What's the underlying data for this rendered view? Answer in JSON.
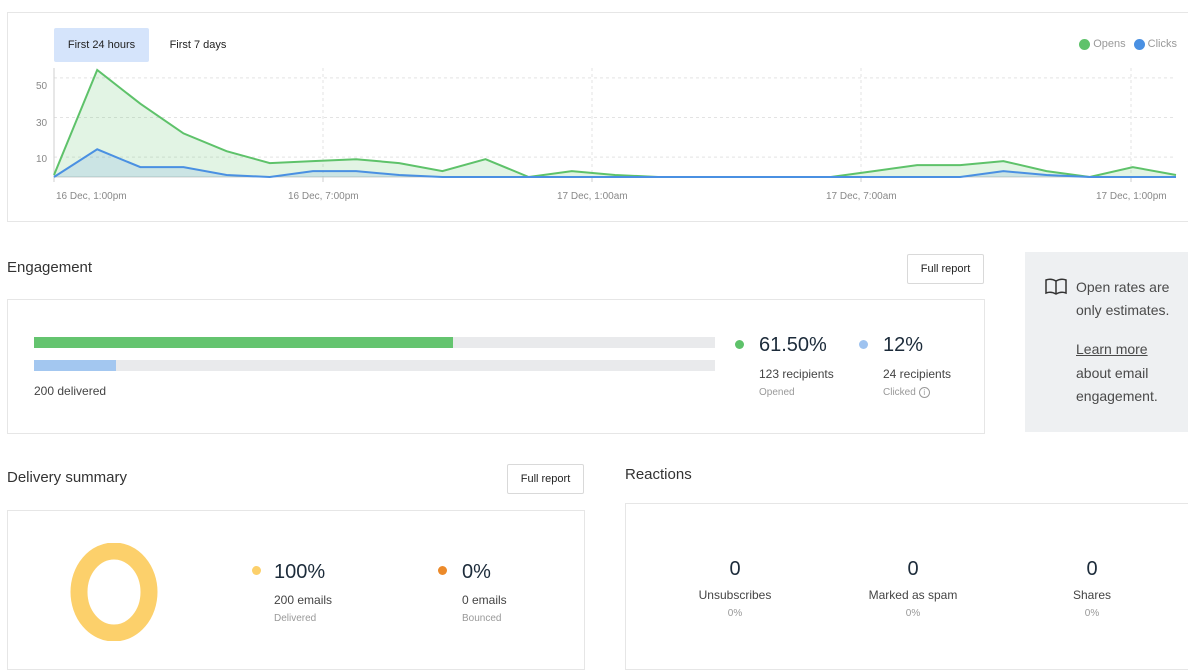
{
  "chart": {
    "tabs": [
      {
        "label": "First 24 hours",
        "active": true
      },
      {
        "label": "First 7 days",
        "active": false
      }
    ],
    "legend": [
      {
        "label": "Opens",
        "color": "#5ec26a"
      },
      {
        "label": "Clicks",
        "color": "#4a90e2"
      }
    ]
  },
  "chart_data": {
    "type": "area",
    "xlabel": "",
    "ylabel": "",
    "ylim": [
      0,
      55
    ],
    "y_ticks": [
      "50",
      "30",
      "10"
    ],
    "x_tick_labels": [
      "16 Dec, 1:00pm",
      "16 Dec, 7:00pm",
      "17 Dec, 1:00am",
      "17 Dec, 7:00am",
      "17 Dec, 1:00pm"
    ],
    "grid": true,
    "legend_position": "top-right",
    "series": [
      {
        "name": "Opens",
        "color": "#5ec26a",
        "values": [
          1,
          54,
          37,
          22,
          13,
          7,
          8,
          9,
          7,
          3,
          9,
          0,
          3,
          1,
          0,
          0,
          0,
          0,
          0,
          3,
          6,
          6,
          8,
          3,
          0,
          5,
          1
        ]
      },
      {
        "name": "Clicks",
        "color": "#4a90e2",
        "values": [
          0,
          14,
          5,
          5,
          1,
          0,
          3,
          3,
          1,
          0,
          0,
          0,
          0,
          0,
          0,
          0,
          0,
          0,
          0,
          0,
          0,
          0,
          3,
          1,
          0,
          0,
          0
        ]
      }
    ]
  },
  "engagement": {
    "title": "Engagement",
    "full_report": "Full report",
    "opened_fraction": 0.615,
    "clicked_fraction": 0.12,
    "delivered_label": "200 delivered",
    "opened": {
      "percent": "61.50%",
      "recipients": "123 recipients",
      "label": "Opened",
      "color": "#5ec26a"
    },
    "clicked": {
      "percent": "12%",
      "recipients": "24 recipients",
      "label": "Clicked",
      "color": "#9ec3f0"
    }
  },
  "info": {
    "line1": "Open rates are",
    "line2": "only estimates.",
    "link": "Learn more",
    "line3": "about email",
    "line4": "engagement."
  },
  "delivery": {
    "title": "Delivery summary",
    "full_report": "Full report",
    "delivered": {
      "percent": "100%",
      "count": "200 emails",
      "label": "Delivered",
      "color": "#fcd06b",
      "fraction": 1.0
    },
    "bounced": {
      "percent": "0%",
      "count": "0 emails",
      "label": "Bounced",
      "color": "#ec8a2a",
      "fraction": 0.0
    }
  },
  "reactions": {
    "title": "Reactions",
    "items": [
      {
        "value": "0",
        "label": "Unsubscribes",
        "percent": "0%"
      },
      {
        "value": "0",
        "label": "Marked as spam",
        "percent": "0%"
      },
      {
        "value": "0",
        "label": "Shares",
        "percent": "0%"
      }
    ]
  }
}
